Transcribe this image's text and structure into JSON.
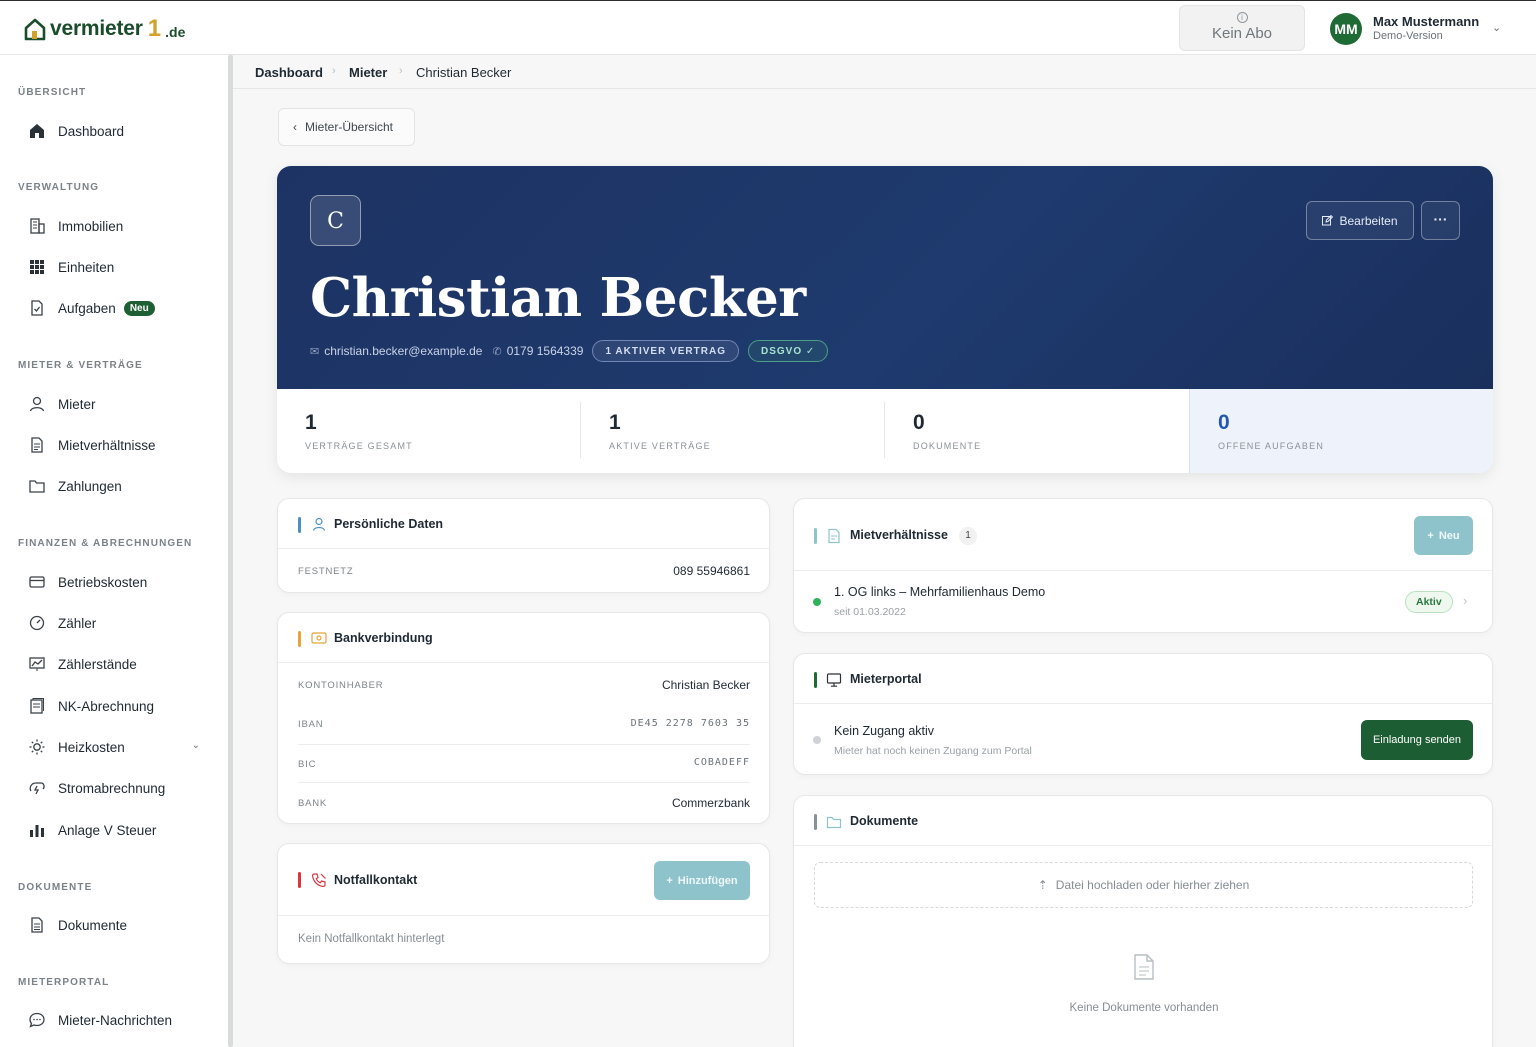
{
  "header": {
    "logo_text": "vermieter",
    "logo_one": "1",
    "logo_tld": ".de",
    "abo_label": "Kein Abo",
    "user_initials": "MM",
    "user_name": "Max Mustermann",
    "user_role": "Demo-Version"
  },
  "sidebar": {
    "sections": [
      {
        "title": "ÜBERSICHT",
        "items": [
          {
            "label": "Dashboard",
            "icon": "home-icon"
          }
        ]
      },
      {
        "title": "VERWALTUNG",
        "items": [
          {
            "label": "Immobilien",
            "icon": "building-icon"
          },
          {
            "label": "Einheiten",
            "icon": "grid-icon"
          },
          {
            "label": "Aufgaben",
            "icon": "task-icon",
            "badge": "Neu"
          }
        ]
      },
      {
        "title": "MIETER & VERTRÄGE",
        "items": [
          {
            "label": "Mieter",
            "icon": "user-icon"
          },
          {
            "label": "Mietverhältnisse",
            "icon": "contract-icon"
          },
          {
            "label": "Zahlungen",
            "icon": "folder-icon"
          }
        ]
      },
      {
        "title": "FINANZEN & ABRECHNUNGEN",
        "items": [
          {
            "label": "Betriebskosten",
            "icon": "card-icon"
          },
          {
            "label": "Zähler",
            "icon": "gauge-icon"
          },
          {
            "label": "Zählerstände",
            "icon": "chart-icon"
          },
          {
            "label": "NK-Abrechnung",
            "icon": "receipt-icon"
          },
          {
            "label": "Heizkosten",
            "icon": "sun-icon"
          },
          {
            "label": "Stromabrechnung",
            "icon": "power-icon"
          },
          {
            "label": "Anlage V Steuer",
            "icon": "bar-chart-icon"
          }
        ]
      },
      {
        "title": "DOKUMENTE",
        "items": [
          {
            "label": "Dokumente",
            "icon": "document-icon"
          }
        ]
      },
      {
        "title": "MIETERPORTAL",
        "items": [
          {
            "label": "Mieter-Nachrichten",
            "icon": "chat-icon"
          }
        ]
      }
    ]
  },
  "breadcrumb": [
    "Dashboard",
    "Mieter",
    "Christian Becker"
  ],
  "back_label": "Mieter-Übersicht",
  "tenant": {
    "initial": "C",
    "name": "Christian Becker",
    "email": "christian.becker@example.de",
    "phone": "0179 1564339",
    "contract_pill": "1 AKTIVER VERTRAG",
    "dsgvo_pill": "DSGVO ✓",
    "edit_label": "Bearbeiten",
    "more_label": "···"
  },
  "stats": [
    {
      "value": "1",
      "label": "VERTRÄGE GESAMT"
    },
    {
      "value": "1",
      "label": "AKTIVE VERTRÄGE"
    },
    {
      "value": "0",
      "label": "DOKUMENTE"
    },
    {
      "value": "0",
      "label": "OFFENE AUFGABEN"
    }
  ],
  "personal": {
    "title": "Persönliche Daten",
    "festnetz_label": "FESTNETZ",
    "festnetz_value": "089 55946861"
  },
  "bank": {
    "title": "Bankverbindung",
    "rows": [
      {
        "label": "KONTOINHABER",
        "value": "Christian Becker"
      },
      {
        "label": "IBAN",
        "value": "DE45 2278 7603 35"
      },
      {
        "label": "BIC",
        "value": "COBADEFF"
      },
      {
        "label": "BANK",
        "value": "Commerzbank"
      }
    ]
  },
  "emergency": {
    "title": "Notfallkontakt",
    "add_label": "Hinzufügen",
    "empty_text": "Kein Notfallkontakt hinterlegt"
  },
  "leases": {
    "title": "Mietverhältnisse",
    "count": "1",
    "new_label": "Neu",
    "items": [
      {
        "name": "1. OG links – Mehrfamilienhaus Demo",
        "since": "seit 01.03.2022",
        "status": "Aktiv"
      }
    ]
  },
  "portal": {
    "title": "Mieterportal",
    "status_title": "Kein Zugang aktiv",
    "status_sub": "Mieter hat noch keinen Zugang zum Portal",
    "invite_label": "Einladung senden"
  },
  "documents": {
    "title": "Dokumente",
    "upload_label": "Datei hochladen oder hierher ziehen",
    "empty_text": "Keine Dokumente vorhanden"
  },
  "colors": {
    "brand_green": "#1c5d33",
    "logo_gold": "#d4a12a",
    "hero_navy": "#1e3a6e",
    "stat_highlight": "#2356b5",
    "teal_button": "#8fc3cc",
    "accent_blue": "#4f8fc0",
    "accent_orange": "#e8a33a",
    "accent_red": "#d9363e",
    "accent_green": "#1f6b35"
  }
}
